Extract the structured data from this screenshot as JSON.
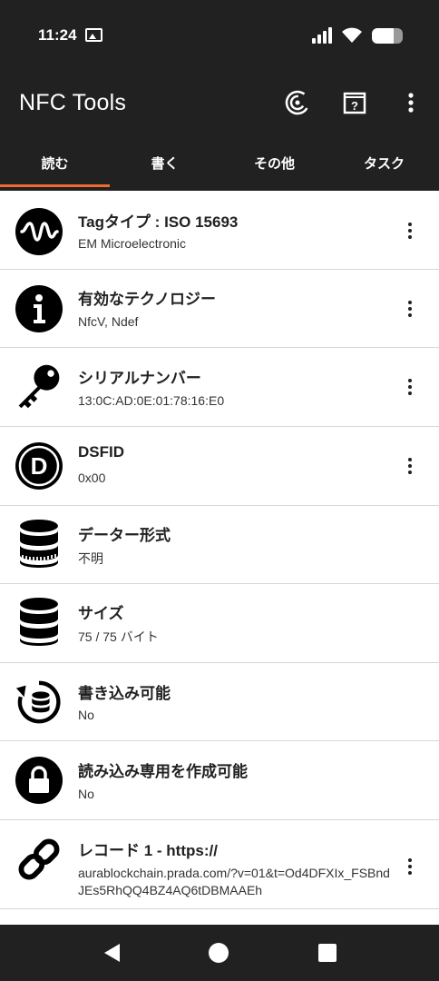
{
  "status_bar": {
    "time": "11:24",
    "signal_bars": 4,
    "battery_level": 0.7
  },
  "app_bar": {
    "title": "NFC Tools",
    "icons": [
      "nfc-scan-icon",
      "help-book-icon",
      "overflow-menu-icon"
    ]
  },
  "tabs": [
    {
      "label": "読む",
      "active": true
    },
    {
      "label": "書く",
      "active": false
    },
    {
      "label": "その他",
      "active": false
    },
    {
      "label": "タスク",
      "active": false
    }
  ],
  "records": [
    {
      "icon": "waveform-icon",
      "title": "Tagタイプ : ISO 15693",
      "value": "EM Microelectronic",
      "has_menu": true
    },
    {
      "icon": "info-icon",
      "title": "有効なテクノロジー",
      "value": "NfcV, Ndef",
      "has_menu": true
    },
    {
      "icon": "key-icon",
      "title": "シリアルナンバー",
      "value": "13:0C:AD:0E:01:78:16:E0",
      "has_menu": true
    },
    {
      "icon": "dsfid-d-icon",
      "title": "DSFID",
      "value": "0x00",
      "has_menu": true
    },
    {
      "icon": "database-format-icon",
      "title": "データー形式",
      "value": "不明",
      "has_menu": false
    },
    {
      "icon": "database-size-icon",
      "title": "サイズ",
      "value": "75 / 75 バイト",
      "has_menu": false
    },
    {
      "icon": "writable-database-icon",
      "title": "書き込み可能",
      "value": "No",
      "has_menu": false
    },
    {
      "icon": "lock-icon",
      "title": "読み込み専用を作成可能",
      "value": "No",
      "has_menu": false
    },
    {
      "icon": "link-icon",
      "title": "レコード 1 - https://",
      "value": "aurablockchain.prada.com/?v=01&t=Od4DFXIx_FSBndJEs5RhQQ4BZ4AQ6tDBMAAEh",
      "has_menu": true
    }
  ],
  "nav_bar": {
    "icons": [
      "back-icon",
      "home-icon",
      "recents-icon"
    ]
  },
  "colors": {
    "bar_background": "#212121",
    "tab_indicator": "#ef6c2f",
    "divider": "#d7d7d7"
  }
}
